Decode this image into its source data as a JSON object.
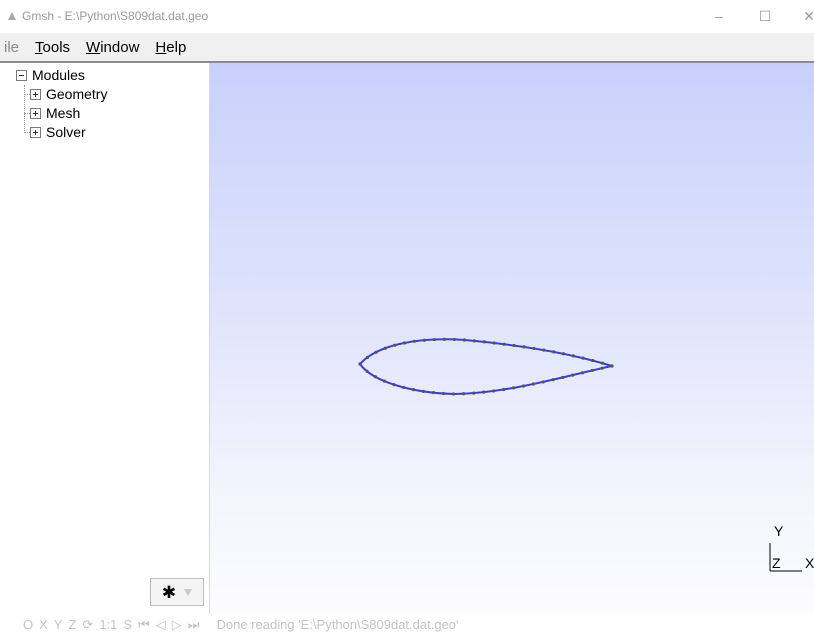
{
  "window": {
    "title": "Gmsh - E:\\Python\\S809dat.dat.geo",
    "icon": "gmsh-app-icon",
    "controls": {
      "minimize": "–",
      "maximize": "☐",
      "close": "✕"
    }
  },
  "menu": {
    "file": "ile",
    "tools_ul": "T",
    "tools_rest": "ools",
    "window_ul": "W",
    "window_rest": "indow",
    "help_ul": "H",
    "help_rest": "elp"
  },
  "tree": {
    "root": "Modules",
    "children": [
      "Geometry",
      "Mesh",
      "Solver"
    ]
  },
  "settings_button": {
    "icon": "gear-icon",
    "glyph": "✱"
  },
  "viewport": {
    "axes": {
      "y": "Y",
      "z": "Z",
      "x": "X"
    },
    "colors": {
      "top": "#c8d1fb",
      "bottom": "#fcfcfe",
      "curve": "#3a3fcf",
      "points": "#555555"
    }
  },
  "statusbar": {
    "buttons": [
      "O",
      "X",
      "Y",
      "Z",
      "⟳",
      "1:1",
      "S",
      "⏮",
      "◁",
      "▷",
      "⏭"
    ],
    "message": "Done reading 'E:\\Python\\S809dat.dat.geo'"
  }
}
